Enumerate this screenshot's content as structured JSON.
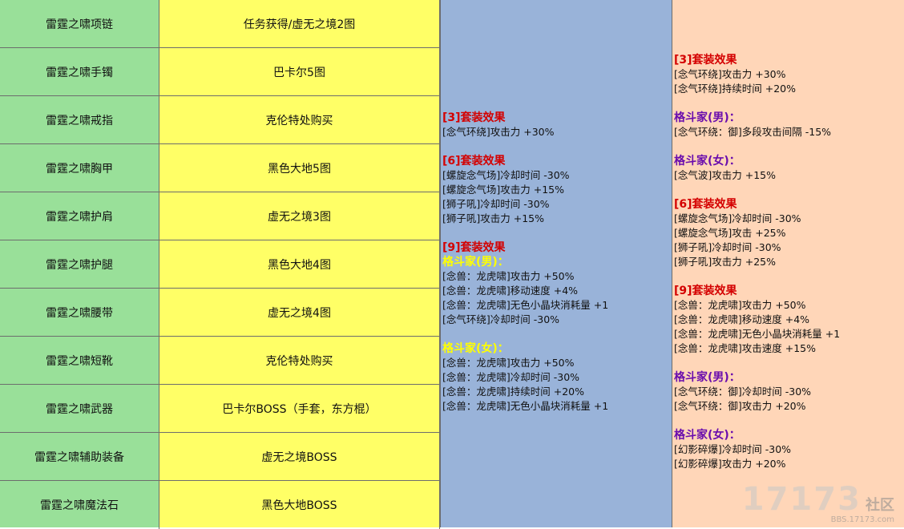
{
  "items": [
    {
      "name": "雷霆之啸项链",
      "source": "任务获得/虚无之境2图"
    },
    {
      "name": "雷霆之啸手镯",
      "source": "巴卡尔5图"
    },
    {
      "name": "雷霆之啸戒指",
      "source": "克伦特处购买"
    },
    {
      "name": "雷霆之啸胸甲",
      "source": "黑色大地5图"
    },
    {
      "name": "雷霆之啸护肩",
      "source": "虚无之境3图"
    },
    {
      "name": "雷霆之啸护腿",
      "source": "黑色大地4图"
    },
    {
      "name": "雷霆之啸腰带",
      "source": "虚无之境4图"
    },
    {
      "name": "雷霆之啸短靴",
      "source": "克伦特处购买"
    },
    {
      "name": "雷霆之啸武器",
      "source": "巴卡尔BOSS（手套，东方棍）"
    },
    {
      "name": "雷霆之啸辅助装备",
      "source": "虚无之境BOSS"
    },
    {
      "name": "雷霆之啸魔法石",
      "source": "黑色大地BOSS"
    }
  ],
  "set_old": {
    "s3_title": "[3]套装效果",
    "s3_lines": [
      "[念气环绕]攻击力 +30%"
    ],
    "s6_title": "[6]套装效果",
    "s6_lines": [
      "[螺旋念气场]冷却时间 -30%",
      "[螺旋念气场]攻击力 +15%",
      "[狮子吼]冷却时间 -30%",
      "[狮子吼]攻击力 +15%"
    ],
    "s9_title": "[9]套装效果",
    "male_title": "格斗家(男)：",
    "male_lines": [
      "[念兽：龙虎啸]攻击力 +50%",
      "[念兽：龙虎啸]移动速度 +4%",
      "[念兽：龙虎啸]无色小晶块消耗量 +1",
      "[念气环绕]冷却时间 -30%"
    ],
    "female_title": "格斗家(女)：",
    "female_lines": [
      "[念兽：龙虎啸]攻击力 +50%",
      "[念兽：龙虎啸]冷却时间 -30%",
      "[念兽：龙虎啸]持续时间 +20%",
      "[念兽：龙虎啸]无色小晶块消耗量 +1"
    ]
  },
  "set_new": {
    "s3_title": "[3]套装效果",
    "s3_lines": [
      "[念气环绕]攻击力 +30%",
      "[念气环绕]持续时间 +20%"
    ],
    "male_a_title": "格斗家(男)：",
    "male_a_lines": [
      "[念气环绕：御]多段攻击间隔 -15%"
    ],
    "female_a_title": "格斗家(女)：",
    "female_a_lines": [
      "[念气波]攻击力 +15%"
    ],
    "s6_title": "[6]套装效果",
    "s6_lines": [
      "[螺旋念气场]冷却时间 -30%",
      "[螺旋念气场]攻击 +25%",
      "[狮子吼]冷却时间 -30%",
      "[狮子吼]攻击力 +25%"
    ],
    "s9_title": "[9]套装效果",
    "s9_lines": [
      "[念兽：龙虎啸]攻击力 +50%",
      "[念兽：龙虎啸]移动速度 +4%",
      "[念兽：龙虎啸]无色小晶块消耗量 +1",
      "[念兽：龙虎啸]攻击速度 +15%"
    ],
    "male_b_title": "格斗家(男)：",
    "male_b_lines": [
      "[念气环绕：御]冷却时间 -30%",
      "[念气环绕：御]攻击力 +20%"
    ],
    "female_b_title": "格斗家(女)：",
    "female_b_lines": [
      "[幻影碎爆]冷却时间 -30%",
      "[幻影碎爆]攻击力 +20%"
    ]
  },
  "watermark": {
    "big": "17173",
    "cn": "社区",
    "url": "BBS.17173.com"
  },
  "colors": {
    "name_col": "#99e099",
    "source_col": "#ffff66",
    "old_col": "#99b3d9",
    "new_col": "#ffd6b8",
    "set_title": "#d40000",
    "female_old": "#ffff00",
    "class_new": "#6a0dad"
  }
}
